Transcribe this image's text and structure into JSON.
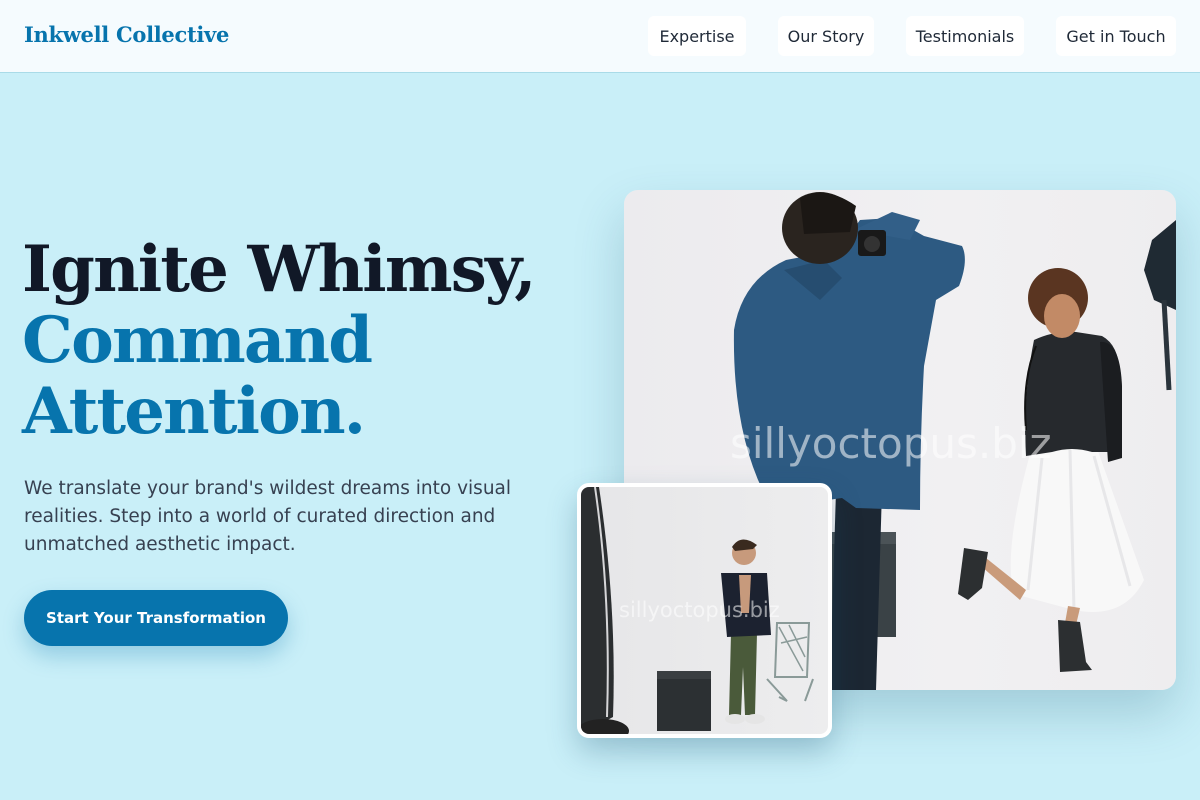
{
  "header": {
    "logo": "Inkwell Collective",
    "nav": [
      "Expertise",
      "Our Story",
      "Testimonials",
      "Get in Touch"
    ]
  },
  "hero": {
    "title_lines": [
      "Ignite Whimsy,",
      "Command",
      "Attention."
    ],
    "description": "We translate your brand's wildest dreams into visual realities. Step into a world of curated direction and unmatched aesthetic impact.",
    "cta_label": "Start Your Transformation"
  },
  "images": {
    "main_watermark": "sillyoctopus.biz",
    "secondary_watermark": "sillyoctopus.biz"
  },
  "colors": {
    "background": "#c9eff8",
    "header_background": "#f5fbfe",
    "accent": "#0774ad",
    "heading_dark": "#111827",
    "body_text": "#374151"
  }
}
